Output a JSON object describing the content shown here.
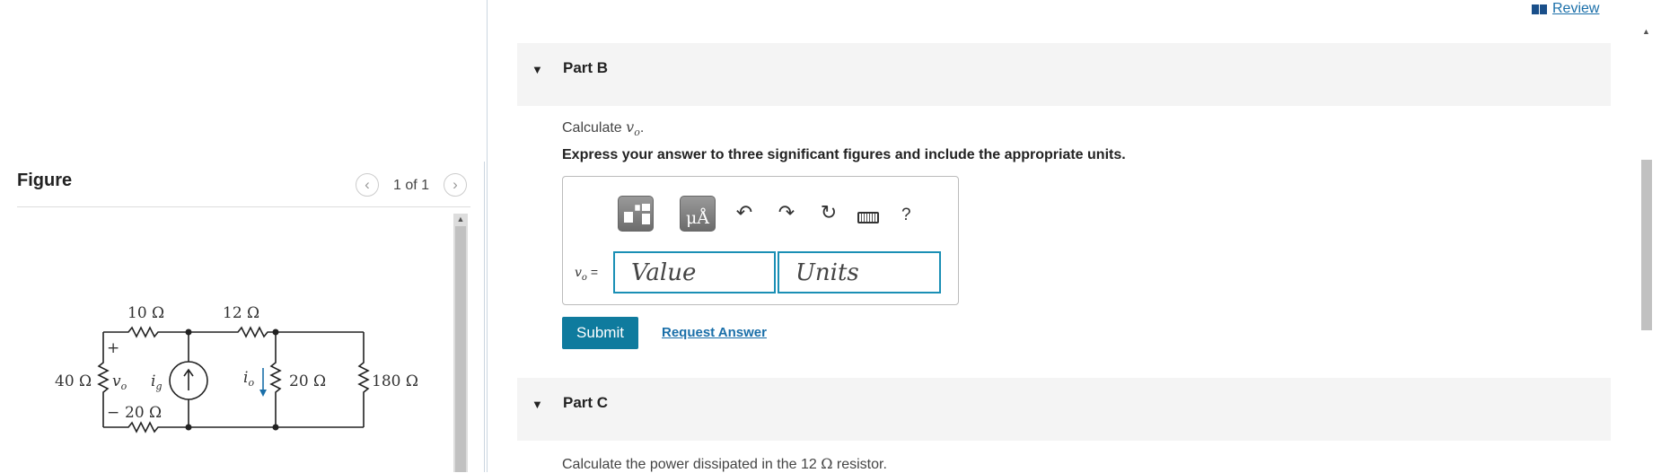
{
  "review": {
    "label": "Review"
  },
  "figure": {
    "title": "Figure",
    "page_count": "1 of 1",
    "prev_icon": "chevron-left-icon",
    "next_icon": "chevron-right-icon",
    "circuit": {
      "r40": "40 Ω",
      "r10": "10 Ω",
      "r12": "12 Ω",
      "r20_bottom": "20 Ω",
      "r20_right": "20 Ω",
      "r180": "180 Ω",
      "vo": "v",
      "vo_sub": "o",
      "ig": "i",
      "ig_sub": "g",
      "io": "i",
      "io_sub": "o",
      "plus": "+",
      "minus": "−"
    }
  },
  "partB": {
    "title": "Part B",
    "question_prefix": "Calculate ",
    "question_var": "vo",
    "question_suffix": ".",
    "instructions": "Express your answer to three significant figures and include the appropriate units.",
    "toolbar": {
      "units_symbol": "μÅ",
      "undo_icon": "↶",
      "redo_icon": "↷",
      "reset_icon": "↻",
      "help_label": "?"
    },
    "answer": {
      "var": "v",
      "var_sub": "o",
      "equals": " =",
      "value_placeholder": "Value",
      "units_placeholder": "Units"
    },
    "submit_label": "Submit",
    "request_answer_label": "Request Answer"
  },
  "partC": {
    "title": "Part C",
    "question_prefix": "Calculate the power dissipated in the 12 ",
    "question_ohm": "Ω",
    "question_suffix": " resistor."
  },
  "colors": {
    "accent": "#0f7b9e",
    "link": "#1a6fa9",
    "part_header_bg": "#f4f4f4"
  }
}
